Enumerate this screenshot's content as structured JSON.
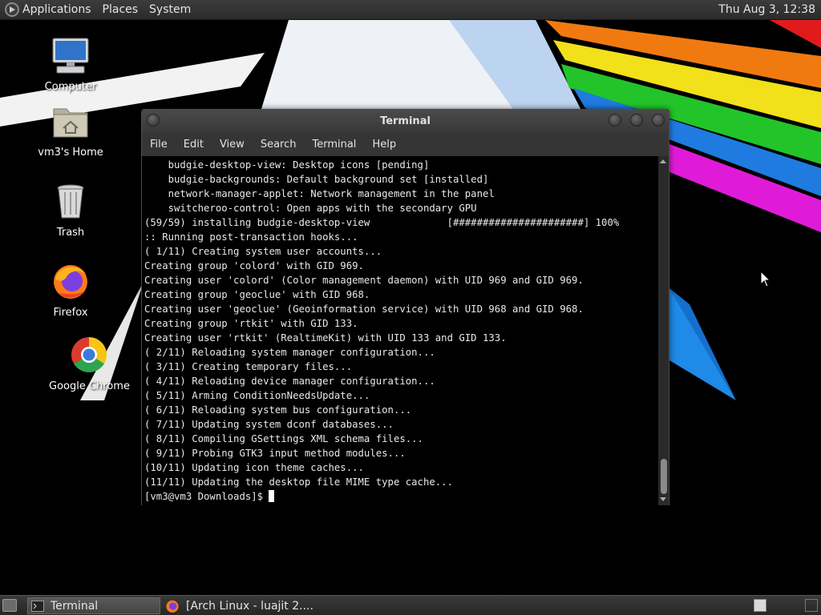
{
  "top_panel": {
    "menus": [
      "Applications",
      "Places",
      "System"
    ],
    "clock": "Thu Aug  3, 12:38"
  },
  "desktop_icons": [
    {
      "label": "Computer",
      "icon": "computer-icon"
    },
    {
      "label": "vm3's Home",
      "icon": "home-folder-icon"
    },
    {
      "label": "Trash",
      "icon": "trash-icon"
    },
    {
      "label": "Firefox",
      "icon": "firefox-icon"
    },
    {
      "label": "Google Chrome",
      "icon": "chrome-icon"
    }
  ],
  "terminal": {
    "title": "Terminal",
    "menus": [
      "File",
      "Edit",
      "View",
      "Search",
      "Terminal",
      "Help"
    ],
    "lines": [
      "    budgie-desktop-view: Desktop icons [pending]",
      "    budgie-backgrounds: Default background set [installed]",
      "    network-manager-applet: Network management in the panel",
      "    switcheroo-control: Open apps with the secondary GPU",
      "(59/59) installing budgie-desktop-view             [######################] 100%",
      ":: Running post-transaction hooks...",
      "( 1/11) Creating system user accounts...",
      "Creating group 'colord' with GID 969.",
      "Creating user 'colord' (Color management daemon) with UID 969 and GID 969.",
      "Creating group 'geoclue' with GID 968.",
      "Creating user 'geoclue' (Geoinformation service) with UID 968 and GID 968.",
      "Creating group 'rtkit' with GID 133.",
      "Creating user 'rtkit' (RealtimeKit) with UID 133 and GID 133.",
      "( 2/11) Reloading system manager configuration...",
      "( 3/11) Creating temporary files...",
      "( 4/11) Reloading device manager configuration...",
      "( 5/11) Arming ConditionNeedsUpdate...",
      "( 6/11) Reloading system bus configuration...",
      "( 7/11) Updating system dconf databases...",
      "( 8/11) Compiling GSettings XML schema files...",
      "( 9/11) Probing GTK3 input method modules...",
      "(10/11) Updating icon theme caches...",
      "(11/11) Updating the desktop file MIME type cache..."
    ],
    "prompt": "[vm3@vm3 Downloads]$ "
  },
  "taskbar": {
    "tasks": [
      {
        "label": "Terminal",
        "icon": "terminal-icon",
        "active": true
      },
      {
        "label": "[Arch Linux - luajit 2....",
        "icon": "firefox-icon",
        "active": false
      }
    ]
  },
  "colors": {
    "panel": "#2b2b2b",
    "terminal_bg": "#000000",
    "terminal_fg": "#e8e8e8"
  }
}
